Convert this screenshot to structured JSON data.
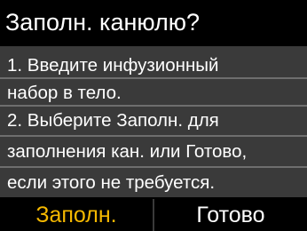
{
  "screen": {
    "title": "Заполн. канюлю?"
  },
  "instructions": {
    "lines": [
      "1. Введите инфузионный",
      "набор в тело.",
      "2. Выберите Заполн. для",
      "заполнения кан. или Готово,",
      "если этого не требуется."
    ]
  },
  "softkeys": {
    "left_label": "Заполн.",
    "right_label": "Готово"
  },
  "colors": {
    "background": "#000000",
    "panel": "#3a3a3a",
    "text": "#ffffff",
    "selected_accent": "#f5b800"
  }
}
